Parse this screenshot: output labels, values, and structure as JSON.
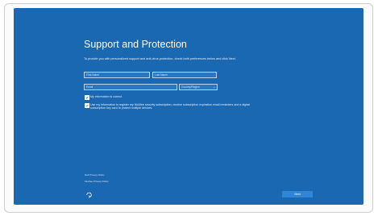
{
  "title": "Support and Protection",
  "description": "To provide you with personalized support and anti-virus protection, check both preferences below and click Next.",
  "form": {
    "first_name_placeholder": "First Name",
    "last_name_placeholder": "Last Name",
    "email_placeholder": "Email",
    "country_placeholder": "Country/Region"
  },
  "checkboxes": [
    {
      "label": "My information is correct.",
      "checked": true
    },
    {
      "label": "Use my information to register my McAfee security subscription, receive subscription expiration email reminders and a digital subscription key card to protect multiple devices.",
      "checked": true
    }
  ],
  "links": {
    "dell_privacy": "Dell Privacy Policy",
    "mcafee_privacy": "McAfee Privacy Policy"
  },
  "icons": {
    "accessibility": "ease-of-access-icon",
    "dropdown": "chevron-down-icon",
    "check": "checkmark-icon"
  },
  "buttons": {
    "next": "Next"
  },
  "colors": {
    "background": "#1a67b2",
    "field": "#2a77c1",
    "button": "#2f86d6",
    "text": "#ffffff"
  }
}
